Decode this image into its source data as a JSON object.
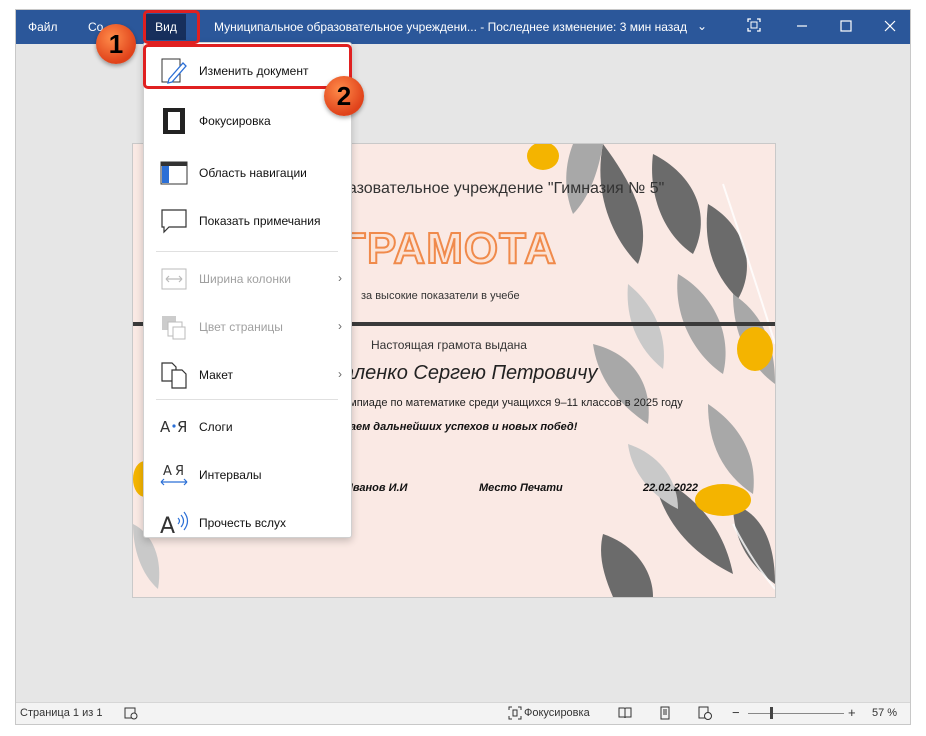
{
  "titlebar": {
    "file_menu": "Файл",
    "second_menu": "Со",
    "view_menu": "Вид",
    "document_title": "Муниципальное образовательное учреждени...  -  Последнее изменение: 3 мин назад",
    "chevron": "⌄"
  },
  "view_menu": {
    "items": [
      {
        "label": "Изменить документ",
        "icon": "edit-pen-icon"
      },
      {
        "label": "Фокусировка",
        "icon": "focus-icon"
      },
      {
        "label": "Область навигации",
        "icon": "navigation-pane-icon"
      },
      {
        "label": "Показать примечания",
        "icon": "comment-icon"
      },
      {
        "label": "Ширина колонки",
        "icon": "column-width-icon",
        "disabled": true
      },
      {
        "label": "Цвет страницы",
        "icon": "page-color-icon",
        "disabled": true
      },
      {
        "label": "Макет",
        "icon": "layout-icon"
      },
      {
        "label": "Слоги",
        "icon": "syllables-icon"
      },
      {
        "label": "Интервалы",
        "icon": "spacing-icon"
      },
      {
        "label": "Прочесть вслух",
        "icon": "read-aloud-icon"
      }
    ]
  },
  "annotations": {
    "step1": "1",
    "step2": "2"
  },
  "certificate": {
    "org_line": "разовательное учреждение \"Гимназия № 5\"",
    "title": "ГРАМОТА",
    "subtitle": "за высокие показатели в учебе",
    "issued_to": "Настоящая грамота выдана",
    "recipient": "аленко Сергею Петровичу",
    "reason": "импиаде по математике среди учащихся 9–11 классов в 2025 году",
    "wish": "лаем дальнейших успехов и новых побед!",
    "signer": "Иванов И.И",
    "stamp": "Место Печати",
    "date": "22.02.2022"
  },
  "statusbar": {
    "page_info": "Страница 1 из 1",
    "focus_label": "Фокусировка",
    "zoom_minus": "−",
    "zoom_plus": "+",
    "zoom_level": "57 %"
  },
  "colors": {
    "titlebar": "#2b579a",
    "active_tab": "#172f5c",
    "highlight": "#e02020",
    "badge": "#f26a2e",
    "page_bg": "#fae9e4",
    "title_orange": "#f08a4b",
    "leaf_gray": "#6b6b6b",
    "leaf_yellow": "#f4b400"
  }
}
